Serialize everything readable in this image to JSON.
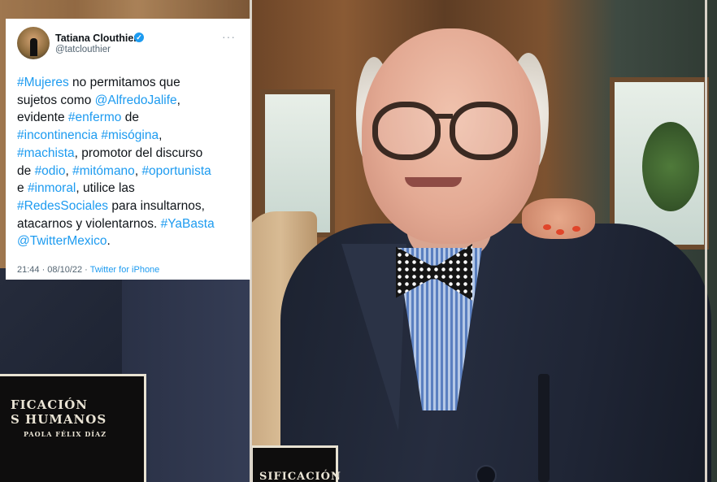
{
  "tweet": {
    "display_name": "Tatiana Clouthier",
    "handle": "@tatclouthier",
    "more_label": "···",
    "verified_icon": "verified-badge-icon",
    "lines": [
      [
        {
          "t": "#Mujeres",
          "tag": true
        },
        {
          "t": " no permitamos que",
          "tag": false
        }
      ],
      [
        {
          "t": "sujetos como ",
          "tag": false
        },
        {
          "t": "@AlfredoJalife",
          "tag": true
        },
        {
          "t": ",",
          "tag": false
        }
      ],
      [
        {
          "t": "evidente ",
          "tag": false
        },
        {
          "t": "#enfermo",
          "tag": true
        },
        {
          "t": " de",
          "tag": false
        }
      ],
      [
        {
          "t": "#incontinencia",
          "tag": true
        },
        {
          "t": " ",
          "tag": false
        },
        {
          "t": "#misógina",
          "tag": true
        },
        {
          "t": ",",
          "tag": false
        }
      ],
      [
        {
          "t": "#machista",
          "tag": true
        },
        {
          "t": ", promotor del discurso",
          "tag": false
        }
      ],
      [
        {
          "t": "de ",
          "tag": false
        },
        {
          "t": "#odio",
          "tag": true
        },
        {
          "t": ", ",
          "tag": false
        },
        {
          "t": "#mitómano",
          "tag": true
        },
        {
          "t": ", ",
          "tag": false
        },
        {
          "t": "#oportunista",
          "tag": true
        }
      ],
      [
        {
          "t": "e ",
          "tag": false
        },
        {
          "t": "#inmoral",
          "tag": true
        },
        {
          "t": ", utilice las",
          "tag": false
        }
      ],
      [
        {
          "t": "#RedesSociales",
          "tag": true
        },
        {
          "t": " para insultarnos,",
          "tag": false
        }
      ],
      [
        {
          "t": "atacarnos y violentarnos. ",
          "tag": false
        },
        {
          "t": "#YaBasta",
          "tag": true
        }
      ],
      [
        {
          "t": "@TwitterMexico",
          "tag": true
        },
        {
          "t": ".",
          "tag": false
        }
      ]
    ],
    "timestamp": "21:44 · 08/10/22 · ",
    "source": "Twitter for iPhone",
    "colors": {
      "link": "#1d9bf0",
      "text": "#0f1419",
      "muted": "#536471"
    }
  },
  "photo": {
    "book_left_title_1": "FICACIÓN",
    "book_left_title_2": "S HUMANOS",
    "book_left_author": "PAOLA FÉLIX DÍAZ",
    "book_right_title": "SIFICACIÓN"
  }
}
